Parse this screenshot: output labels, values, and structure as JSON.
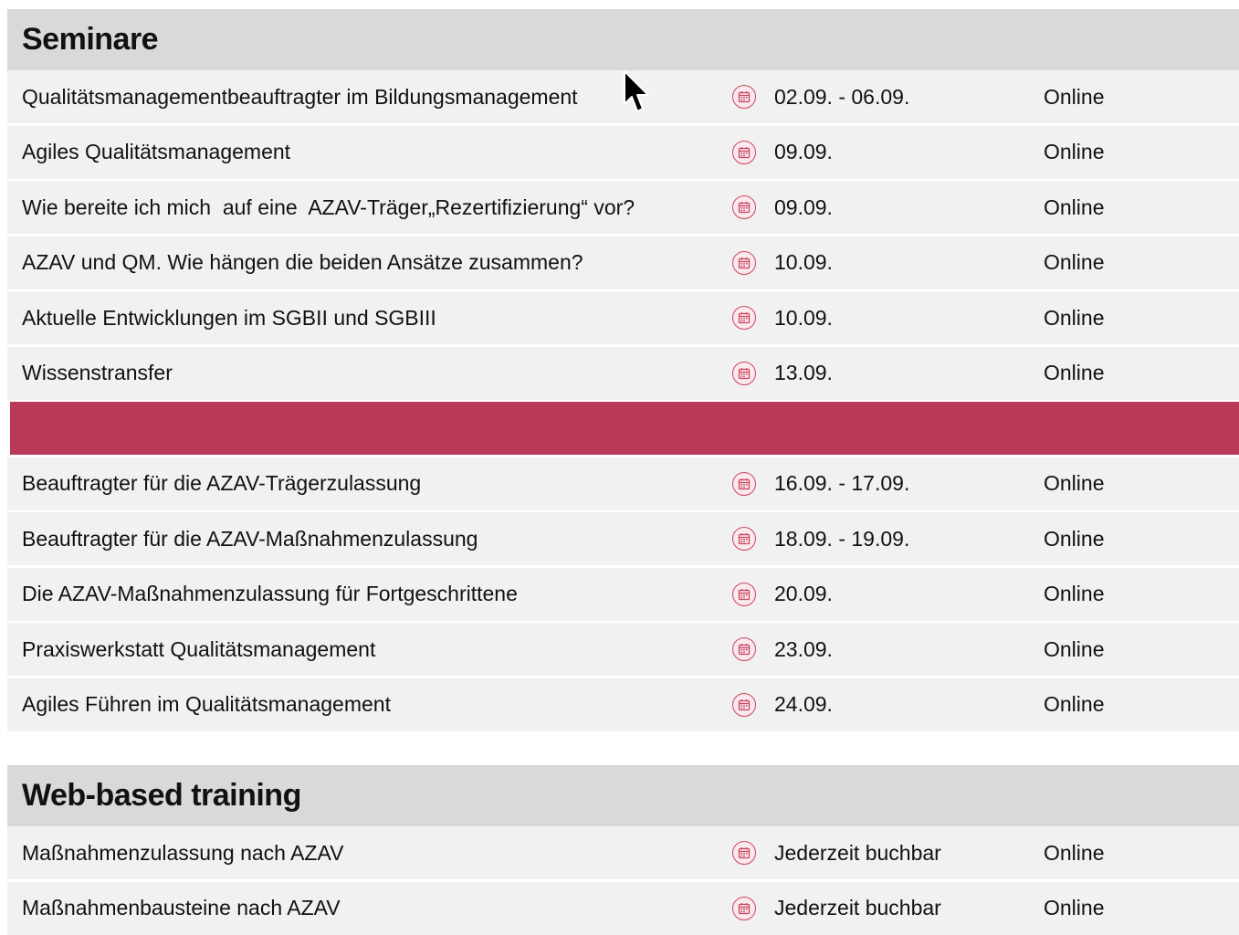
{
  "seminare": {
    "title": "Seminare",
    "rows_before": [
      {
        "title": "Qualitätsmanagementbeauftragter im Bildungsmanagement",
        "date": "02.09. - 06.09.",
        "location": "Online"
      },
      {
        "title": "Agiles Qualitätsmanagement",
        "date": "09.09.",
        "location": "Online"
      },
      {
        "title": "Wie bereite ich mich  auf eine  AZAV-Träger„Rezertifizierung“ vor?",
        "date": "09.09.",
        "location": "Online"
      },
      {
        "title": "AZAV und QM. Wie hängen die beiden Ansätze zusammen?",
        "date": "10.09.",
        "location": "Online"
      },
      {
        "title": "Aktuelle Entwicklungen im SGBII und SGBIII",
        "date": "10.09.",
        "location": "Online"
      },
      {
        "title": "Wissenstransfer",
        "date": "13.09.",
        "location": "Online"
      }
    ],
    "rows_after": [
      {
        "title": "Beauftragter für die AZAV-Trägerzulassung",
        "date": "16.09. - 17.09.",
        "location": "Online"
      },
      {
        "title": "Beauftragter für die AZAV-Maßnahmenzulassung",
        "date": "18.09. - 19.09.",
        "location": "Online"
      },
      {
        "title": "Die AZAV-Maßnahmenzulassung für Fortgeschrittene",
        "date": "20.09.",
        "location": "Online"
      },
      {
        "title": "Praxiswerkstatt Qualitätsmanagement",
        "date": "23.09.",
        "location": "Online"
      },
      {
        "title": "Agiles Führen im Qualitätsmanagement",
        "date": "24.09.",
        "location": "Online"
      }
    ]
  },
  "wbt": {
    "title": "Web-based training",
    "rows": [
      {
        "title": "Maßnahmenzulassung nach AZAV",
        "date": "Jederzeit buchbar",
        "location": "Online"
      },
      {
        "title": "Maßnahmenbausteine nach AZAV",
        "date": "Jederzeit buchbar",
        "location": "Online"
      }
    ]
  },
  "icons": {
    "date": "calendar-icon",
    "cursor": "mouse-pointer-icon"
  },
  "colors": {
    "header_bg": "#d9d9d9",
    "row_bg": "#f1f1f1",
    "accent": "#b93a57",
    "icon_ring": "#c94760"
  }
}
